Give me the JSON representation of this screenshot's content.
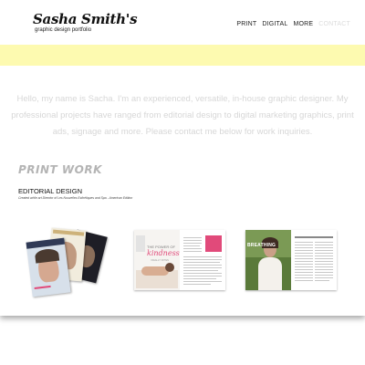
{
  "logo": {
    "name": "Sasha Smith's",
    "tagline": "graphic design portfolio"
  },
  "nav": [
    {
      "label": "PRINT"
    },
    {
      "label": "DIGITAL"
    },
    {
      "label": "MORE"
    },
    {
      "label": "CONTACT"
    }
  ],
  "intro": {
    "text": "Hello, my name is Sacha. I'm an experienced, versatile, in-house graphic designer. My professional projects have ranged from editorial design to digital marketing graphics, print ads, signage and more. Please contact me below for work inquiries."
  },
  "section": {
    "title": "PRINT WORK",
    "subtitle": "EDITORIAL DESIGN",
    "caption": "Created while art Director of Les Nouvelles Esthétiques and Spa - American Edition"
  },
  "thumbnails": [
    {
      "icon": "magazine-covers-image"
    },
    {
      "headline": "THE POWER OF",
      "script": "kindness",
      "tail": "I REALLY OFTEN"
    },
    {
      "headline": "BREATHING"
    }
  ],
  "colors": {
    "banner": "#fdfab0",
    "intro_text": "#d7d7d7",
    "section_title": "#b4b4b4",
    "accent_pink": "#e14a7a"
  }
}
